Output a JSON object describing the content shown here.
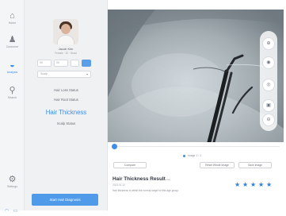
{
  "rail": {
    "items": [
      {
        "label": "Home",
        "icon": "home-icon",
        "glyph": "⌂"
      },
      {
        "label": "Customer",
        "icon": "user-icon",
        "glyph": "♟"
      },
      {
        "label": "Analysis",
        "icon": "drop-icon",
        "glyph": "◒"
      },
      {
        "label": "Search",
        "icon": "search-icon",
        "glyph": "⚲"
      },
      {
        "label": "Settings",
        "icon": "gear-icon",
        "glyph": "⚙"
      }
    ]
  },
  "profile": {
    "name": "Jacob Kim",
    "info": "Female · 32 · Seoul"
  },
  "inputs": {
    "field_a": "00",
    "field_b": "00"
  },
  "dropdown": {
    "value": "Scalp"
  },
  "menu": {
    "hair_loss": "Hair Loss Status",
    "hair_root": "Hair Root Status",
    "hair_thickness": "Hair Thickness",
    "scalp": "Scalp Status"
  },
  "start_button": "Start Hair Diagnosis",
  "timeline": {
    "label": "Image 1 / 1"
  },
  "actions": {
    "compare": "Compare",
    "reset_image": "Reset Whole Image",
    "save_image": "Save Image"
  },
  "result": {
    "title": "Hair Thickness Result",
    "badge": "Normal",
    "date": "2023.01.12",
    "description": "Hair thickness is within the normal range for this age group.",
    "rating": 5
  },
  "colors": {
    "accent": "#3d8ee8",
    "button": "#4f9be9"
  }
}
